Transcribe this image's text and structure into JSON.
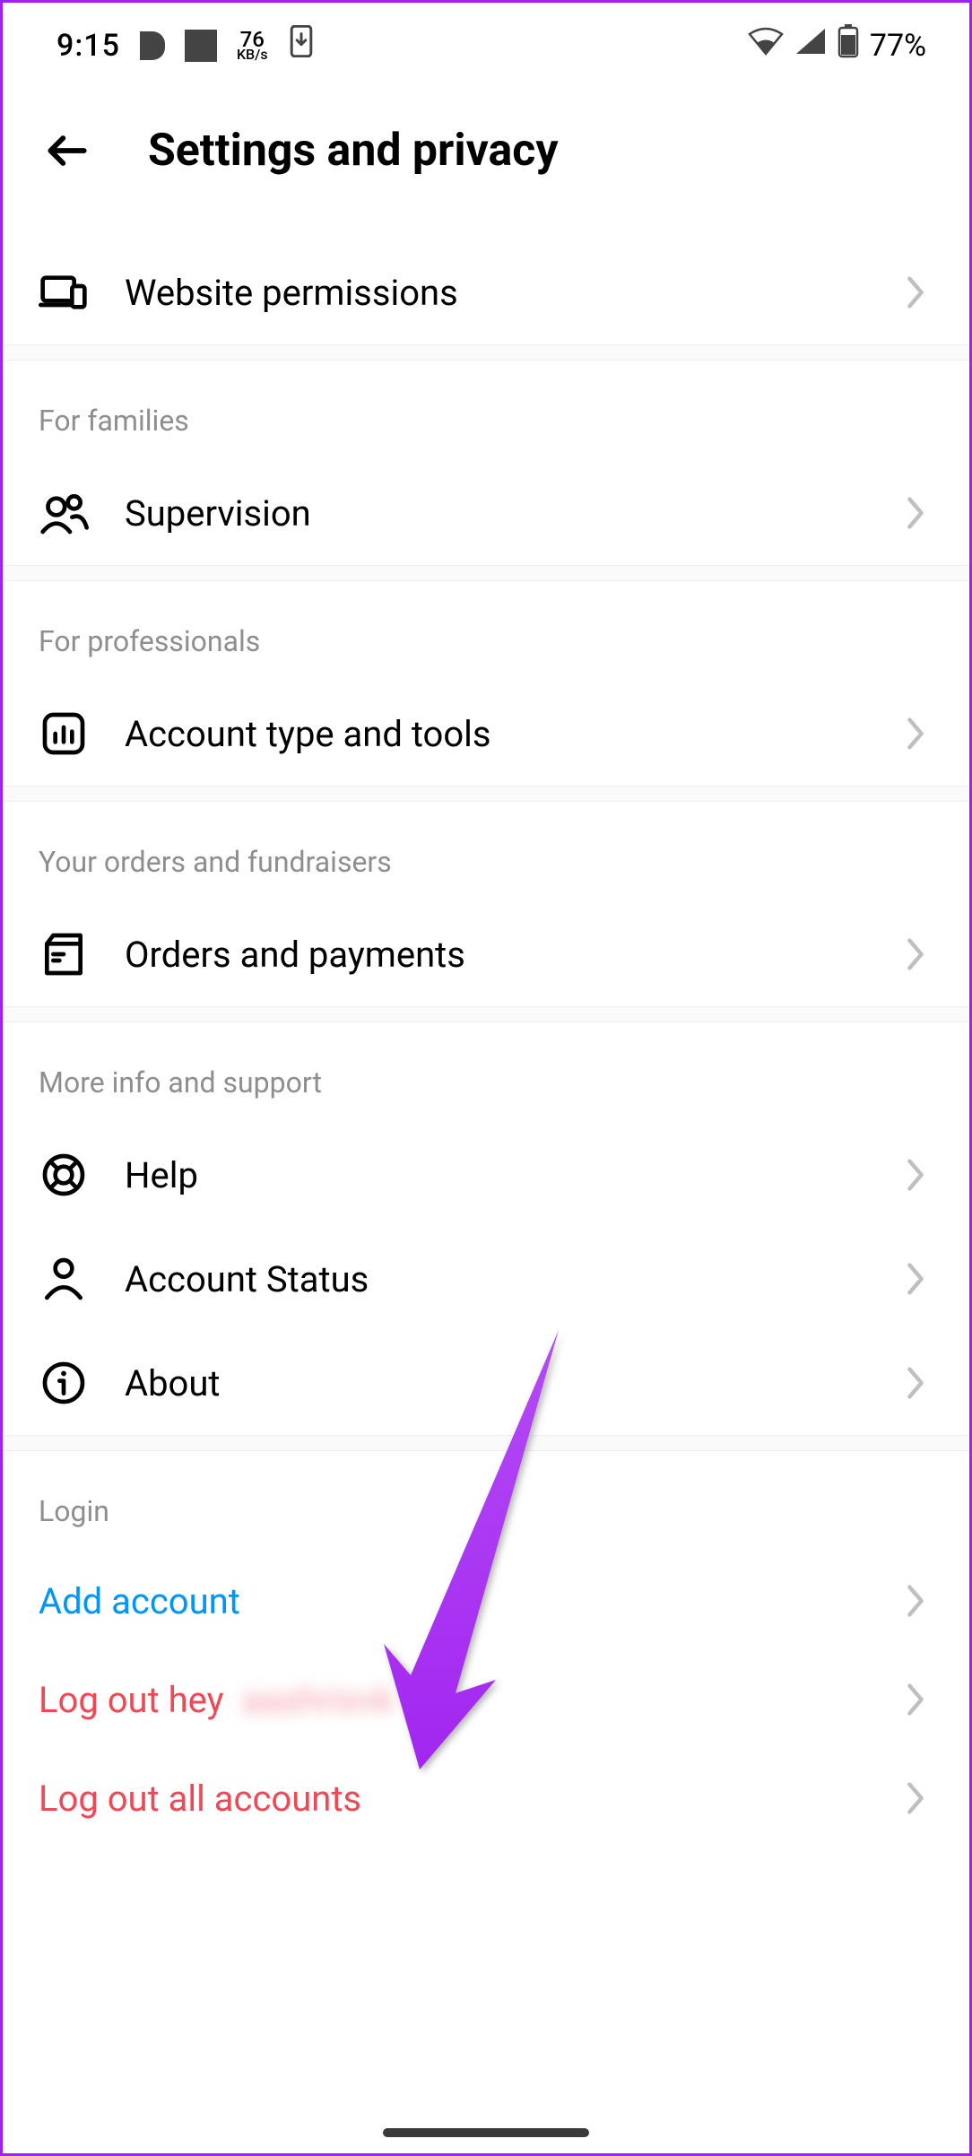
{
  "status": {
    "time": "9:15",
    "net_speed_num": "76",
    "net_speed_unit": "KB/s",
    "battery_pct": "77%"
  },
  "header": {
    "title": "Settings and privacy"
  },
  "sections": {
    "top": [
      {
        "label": "Website permissions"
      }
    ],
    "families_header": "For families",
    "families": [
      {
        "label": "Supervision"
      }
    ],
    "pros_header": "For professionals",
    "pros": [
      {
        "label": "Account type and tools"
      }
    ],
    "orders_header": "Your orders and fundraisers",
    "orders": [
      {
        "label": "Orders and payments"
      }
    ],
    "support_header": "More info and support",
    "support": [
      {
        "label": "Help"
      },
      {
        "label": "Account Status"
      },
      {
        "label": "About"
      }
    ],
    "login_header": "Login",
    "login": {
      "add": "Add account",
      "logout_prefix": "Log out hey",
      "logout_name_blurred": "aashrisvk",
      "logout_all": "Log out all accounts"
    }
  }
}
